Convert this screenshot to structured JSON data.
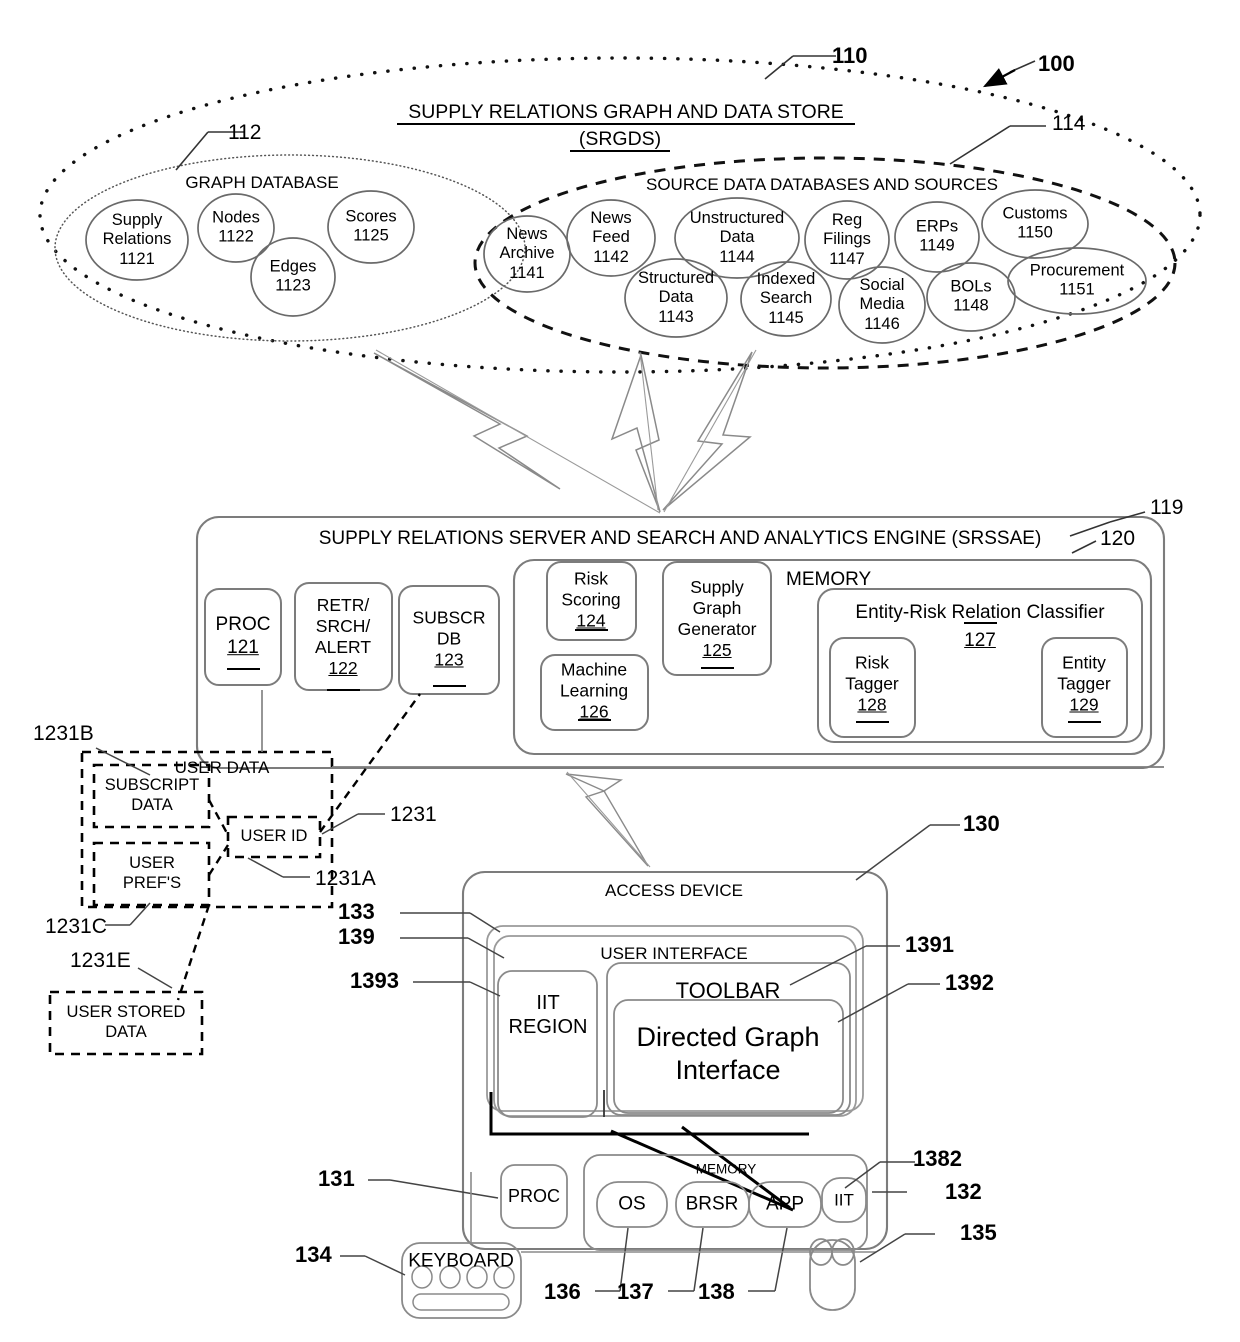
{
  "figure": {
    "system_ref": "100",
    "srgds": {
      "ref": "110",
      "title_line1": "SUPPLY RELATIONS GRAPH AND DATA STORE",
      "title_line2": "(SRGDS)",
      "graph_database": {
        "ref": "112",
        "caption": "GRAPH DATABASE",
        "nodes": [
          {
            "label": "Supply\nRelations",
            "num": "1121"
          },
          {
            "label": "Nodes",
            "num": "1122"
          },
          {
            "label": "Edges",
            "num": "1123"
          },
          {
            "label": "Scores",
            "num": "1125"
          }
        ]
      },
      "source_data": {
        "ref": "114",
        "caption": "SOURCE DATA DATABASES AND SOURCES",
        "nodes": [
          {
            "label": "News\nArchive",
            "num": "1141"
          },
          {
            "label": "News\nFeed",
            "num": "1142"
          },
          {
            "label": "Structured\nData",
            "num": "1143"
          },
          {
            "label": "Unstructured\nData",
            "num": "1144"
          },
          {
            "label": "Indexed\nSearch",
            "num": "1145"
          },
          {
            "label": "Social\nMedia",
            "num": "1146"
          },
          {
            "label": "Reg\nFilings",
            "num": "1147"
          },
          {
            "label": "BOLs",
            "num": "1148"
          },
          {
            "label": "ERPs",
            "num": "1149"
          },
          {
            "label": "Customs",
            "num": "1150"
          },
          {
            "label": "Procurement",
            "num": "1151"
          }
        ]
      }
    },
    "server": {
      "ref": "119",
      "title": "SUPPLY RELATIONS SERVER AND SEARCH AND ANALYTICS ENGINE (SRSSAE)",
      "modules": [
        {
          "label": "PROC",
          "num": "121"
        },
        {
          "label": "RETR/\nSRCH/\nALERT",
          "num": "122"
        },
        {
          "label": "SUBSCR\nDB",
          "num": "123"
        }
      ],
      "memory": {
        "ref": "120",
        "caption": "MEMORY",
        "modules": [
          {
            "label": "Risk\nScoring",
            "num": "124"
          },
          {
            "label": "Supply\nGraph\nGenerator",
            "num": "125"
          },
          {
            "label": "Machine\nLearning",
            "num": "126"
          }
        ],
        "classifier": {
          "caption": "Entity-Risk Relation Classifier",
          "num": "127",
          "modules": [
            {
              "label": "Risk\nTagger",
              "num": "128"
            },
            {
              "label": "Entity\nTagger",
              "num": "129"
            }
          ]
        }
      }
    },
    "user_data": {
      "ref": "1231",
      "caption": "USER DATA",
      "user_id": {
        "caption": "USER ID",
        "ref": "1231A"
      },
      "subscript_data": {
        "caption": "SUBSCRIPT\nDATA",
        "ref": "1231B"
      },
      "user_prefs": {
        "caption": "USER\nPREF'S",
        "ref": "1231C"
      },
      "user_stored_data": {
        "caption": "USER STORED\nDATA",
        "ref": "1231E"
      }
    },
    "access_device": {
      "ref": "130",
      "caption": "ACCESS DEVICE",
      "display_ref": "133",
      "ui": {
        "ref": "139",
        "caption": "USER INTERFACE",
        "iit_region": {
          "caption": "IIT\nREGION",
          "ref": "1393"
        },
        "toolbar": {
          "caption": "TOOLBAR",
          "ref": "1391"
        },
        "directed_graph": {
          "caption": "Directed Graph\nInterface",
          "ref": "1392"
        }
      },
      "proc": {
        "caption": "PROC",
        "ref": "131"
      },
      "memory": {
        "caption": "MEMORY",
        "ref": "132",
        "modules": [
          {
            "label": "OS",
            "ref": "136"
          },
          {
            "label": "BRSR",
            "ref": "137"
          },
          {
            "label": "APP",
            "ref": "138"
          },
          {
            "label": "IIT",
            "ref": "1382"
          }
        ]
      },
      "keyboard": {
        "caption": "KEYBOARD",
        "ref": "134"
      },
      "mouse": {
        "ref": "135"
      }
    }
  },
  "colors": {
    "line": "#3a3a3a",
    "ink": "#000000",
    "bg": "#ffffff"
  }
}
